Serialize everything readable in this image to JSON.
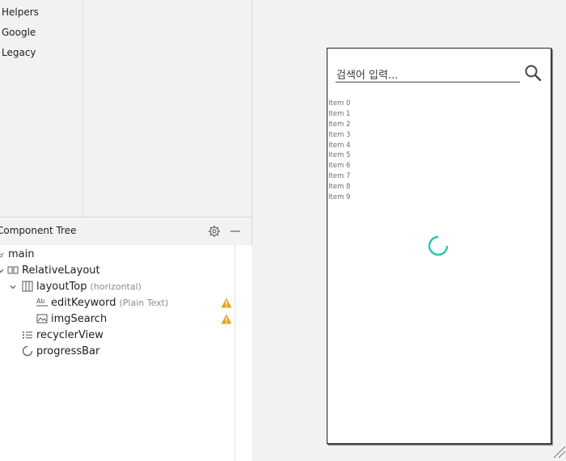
{
  "palette": {
    "categories": [
      "Helpers",
      "Google",
      "Legacy"
    ]
  },
  "component_tree": {
    "title": "Component Tree",
    "nodes": [
      {
        "label": "main",
        "hint": ""
      },
      {
        "label": "RelativeLayout",
        "hint": ""
      },
      {
        "label": "layoutTop",
        "hint": "(horizontal)"
      },
      {
        "label": "editKeyword",
        "hint": "(Plain Text)"
      },
      {
        "label": "imgSearch",
        "hint": ""
      },
      {
        "label": "recyclerView",
        "hint": ""
      },
      {
        "label": "progressBar",
        "hint": ""
      }
    ]
  },
  "preview": {
    "search_hint": "검색어 입력...",
    "items": [
      "Item 0",
      "Item 1",
      "Item 2",
      "Item 3",
      "Item 4",
      "Item 5",
      "Item 6",
      "Item 7",
      "Item 8",
      "Item 9"
    ]
  },
  "colors": {
    "warning": "#e8a317",
    "progress": "#26c6b0",
    "accent_text": "#1e1e1e"
  }
}
